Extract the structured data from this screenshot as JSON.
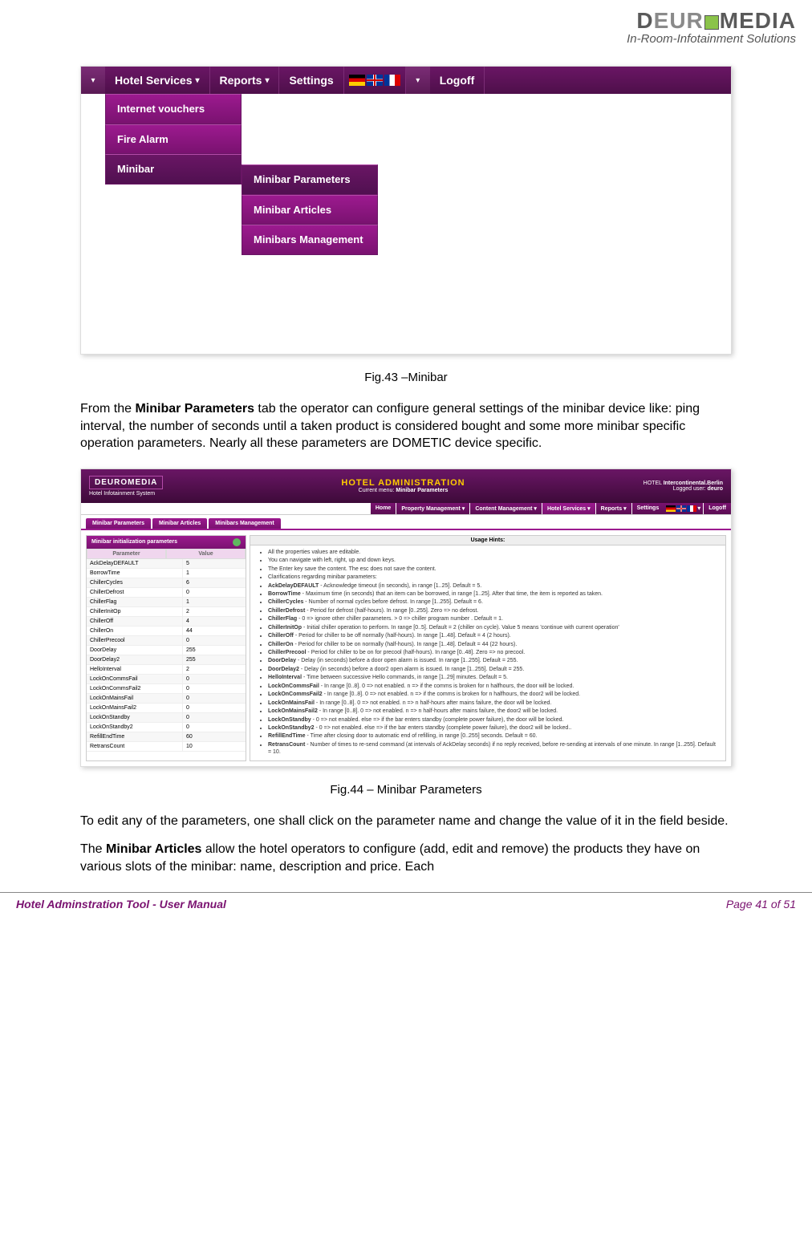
{
  "header": {
    "brand_d": "D",
    "brand_eur": "EUR",
    "brand_media": "MEDIA",
    "tagline": "In-Room-Infotainment Solutions"
  },
  "fig1": {
    "nav": {
      "hotel_services": "Hotel Services",
      "reports": "Reports",
      "settings": "Settings",
      "logoff": "Logoff"
    },
    "menu1": [
      "Internet vouchers",
      "Fire Alarm",
      "Minibar"
    ],
    "menu2": [
      "Minibar Parameters",
      "Minibar Articles",
      "Minibars Management"
    ],
    "caption": "Fig.43 –Minibar"
  },
  "para1a": "From the ",
  "para1b": "Minibar Parameters",
  "para1c": " tab the operator can configure general settings of the minibar device like: ping interval, the number of seconds until a taken product is considered bought and some more minibar specific operation parameters. Nearly all these parameters are DOMETIC device specific.",
  "fig2": {
    "header": {
      "logo": "DEUROMEDIA",
      "logo_sub": "Hotel Infotainment System",
      "title": "HOTEL ADMINISTRATION",
      "menu_label": "Current menu:",
      "menu_value": "Minibar Parameters",
      "hotel_label": "HOTEL",
      "hotel_value": "Intercontinental.Berlin",
      "user_label": "Logged user:",
      "user_value": "deuro"
    },
    "nav": [
      "Home",
      "Property Management",
      "Content Management",
      "Hotel Services",
      "Reports",
      "Settings",
      "Logoff"
    ],
    "tabs": [
      "Minibar Parameters",
      "Minibar Articles",
      "Minibars Management"
    ],
    "panel_left_title": "Minibar initialization parameters",
    "col_param": "Parameter",
    "col_value": "Value",
    "params": [
      {
        "k": "AckDelayDEFAULT",
        "v": "5"
      },
      {
        "k": "BorrowTime",
        "v": "1"
      },
      {
        "k": "ChillerCycles",
        "v": "6"
      },
      {
        "k": "ChillerDefrost",
        "v": "0"
      },
      {
        "k": "ChillerFlag",
        "v": "1"
      },
      {
        "k": "ChillerInitOp",
        "v": "2"
      },
      {
        "k": "ChillerOff",
        "v": "4"
      },
      {
        "k": "ChillerOn",
        "v": "44"
      },
      {
        "k": "ChillerPrecool",
        "v": "0"
      },
      {
        "k": "DoorDelay",
        "v": "255"
      },
      {
        "k": "DoorDelay2",
        "v": "255"
      },
      {
        "k": "HelloInterval",
        "v": "2"
      },
      {
        "k": "LockOnCommsFail",
        "v": "0"
      },
      {
        "k": "LockOnCommsFail2",
        "v": "0"
      },
      {
        "k": "LockOnMainsFail",
        "v": "0"
      },
      {
        "k": "LockOnMainsFail2",
        "v": "0"
      },
      {
        "k": "LockOnStandby",
        "v": "0"
      },
      {
        "k": "LockOnStandby2",
        "v": "0"
      },
      {
        "k": "RefillEndTime",
        "v": "60"
      },
      {
        "k": "RetransCount",
        "v": "10"
      }
    ],
    "hints_title": "Usage Hints:",
    "hints_intro": [
      "All the properties values are editable.",
      "You can navigate with left, right, up and down keys.",
      "The Enter key save the content. The esc does not save the content.",
      "Clarifications regarding minibar parameters:"
    ],
    "hints_params": [
      {
        "n": "AckDelayDEFAULT",
        "d": " - Acknowledge timeout (in seconds), in range [1..25]. Default = 5."
      },
      {
        "n": "BorrowTime",
        "d": " - Maximum time (in seconds) that an item can be borrowed, in range [1..25]. After that time, the item is reported as taken."
      },
      {
        "n": "ChillerCycles",
        "d": " - Number of normal cycles before defrost. In range [1..255]. Default = 6."
      },
      {
        "n": "ChillerDefrost",
        "d": " - Period for defrost (half-hours). In range [0..255]. Zero => no defrost."
      },
      {
        "n": "ChillerFlag",
        "d": " - 0 => ignore other chiller parameters. > 0 => chiller program number . Default = 1."
      },
      {
        "n": "ChillerInitOp",
        "d": " - Initial chiller operation to perform. In range [0..5]. Default = 2 (chiller on cycle). Value 5 means 'continue with current operation'"
      },
      {
        "n": "ChillerOff",
        "d": " - Period for chiller to be off normally (half-hours). In range [1..48]. Default = 4 (2 hours)."
      },
      {
        "n": "ChillerOn",
        "d": " - Period for chiller to be on normally (half-hours). In range [1..48]. Default = 44 (22 hours)."
      },
      {
        "n": "ChillerPrecool",
        "d": " - Period for chiller to be on for precool (half-hours). In range [0..48]. Zero => no precool."
      },
      {
        "n": "DoorDelay",
        "d": " - Delay (in seconds) before a door open alarm is issued. In range [1..255]. Default = 255."
      },
      {
        "n": "DoorDelay2",
        "d": " - Delay (in seconds) before a door2 open alarm is issued. In range [1..255]. Default = 255."
      },
      {
        "n": "HelloInterval",
        "d": " - Time between successive Hello commands, in range [1..29] minutes. Default = 5."
      },
      {
        "n": "LockOnCommsFail",
        "d": " - In range [0..8]. 0 => not enabled. n => if the comms is broken for n halfhours, the door will be locked."
      },
      {
        "n": "LockOnCommsFail2",
        "d": " - In range [0..8]. 0 => not enabled. n => if the comms is broken for n halfhours, the door2 will be locked."
      },
      {
        "n": "LockOnMainsFail",
        "d": " - In range [0..8]. 0 => not enabled. n => n half-hours after mains failure, the door will be locked."
      },
      {
        "n": "LockOnMainsFail2",
        "d": " - In range [0..8]. 0 => not enabled. n => n half-hours after mains failure, the door2 will be locked."
      },
      {
        "n": "LockOnStandby",
        "d": " - 0 => not enabled. else => if the bar enters standby (complete power failure), the door will be locked."
      },
      {
        "n": "LockOnStandby2",
        "d": " - 0 => not enabled. else => if the bar enters standby (complete power failure), the door2 will be locked.."
      },
      {
        "n": "RefillEndTime",
        "d": " - Time after closing door to automatic end of refilling, in range [0..255] seconds. Default = 60."
      },
      {
        "n": "RetransCount",
        "d": " - Number of times to re-send command (at intervals of AckDelay seconds) if no reply received, before re-sending at intervals of one minute. In range [1..255]. Default = 10."
      }
    ],
    "caption": "Fig.44 – Minibar Parameters"
  },
  "para2": "To edit any of the parameters, one shall click on the parameter name and change the value of it in the field beside.",
  "para3a": "The ",
  "para3b": "Minibar Articles",
  "para3c": " allow the hotel operators to configure (add, edit and remove) the products they have on various slots of the minibar: name, description and price. Each",
  "footer": {
    "left": "Hotel Adminstration Tool - User Manual",
    "right": "Page 41 of 51"
  }
}
